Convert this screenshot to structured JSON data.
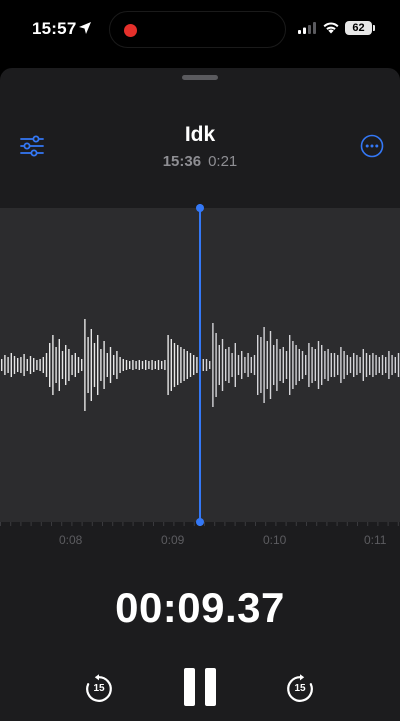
{
  "status_bar": {
    "time": "15:57",
    "location_icon": "location-arrow-icon",
    "signal_icon": "cellular-signal-icon",
    "wifi_icon": "wifi-icon",
    "battery_level": "62",
    "recording_indicator_color": "#e5302b"
  },
  "recording": {
    "title": "Idk",
    "recorded_time": "15:36",
    "duration": "0:21"
  },
  "toolbar": {
    "edit_icon": "sliders-icon",
    "more_icon": "ellipsis-circle-icon"
  },
  "timeline": {
    "labels": [
      "0:08",
      "0:09",
      "0:10",
      "0:11"
    ]
  },
  "playback": {
    "elapsed": "00:09.37",
    "skip_back_seconds": "15",
    "skip_forward_seconds": "15",
    "state": "playing",
    "pause_icon": "pause-icon"
  },
  "colors": {
    "accent": "#3478f6",
    "sheet_background": "#1c1c1e",
    "waveform_background": "#2c2c2e"
  }
}
